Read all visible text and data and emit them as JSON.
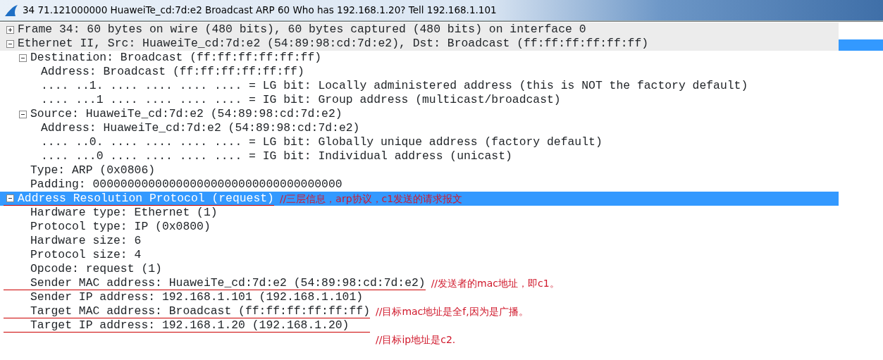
{
  "window": {
    "title": "34 71.121000000 HuaweiTe_cd:7d:e2 Broadcast ARP 60 Who has 192.168.1.20?  Tell 192.168.1.101"
  },
  "tree": [
    {
      "text": "Frame 34: 60 bytes on wire (480 bits), 60 bytes captured (480 bits) on interface 0",
      "expanded": false,
      "selected": false
    },
    {
      "text": "Ethernet II, Src: HuaweiTe_cd:7d:e2 (54:89:98:cd:7d:e2), Dst: Broadcast (ff:ff:ff:ff:ff:ff)",
      "expanded": true,
      "selected": false,
      "marked": true,
      "children": [
        {
          "text": "Destination: Broadcast (ff:ff:ff:ff:ff:ff)",
          "expanded": true,
          "children": [
            {
              "text": "Address: Broadcast (ff:ff:ff:ff:ff:ff)"
            },
            {
              "text": ".... ..1. .... .... .... .... = LG bit: Locally administered address (this is NOT the factory default)"
            },
            {
              "text": ".... ...1 .... .... .... .... = IG bit: Group address (multicast/broadcast)"
            }
          ]
        },
        {
          "text": "Source: HuaweiTe_cd:7d:e2 (54:89:98:cd:7d:e2)",
          "expanded": true,
          "children": [
            {
              "text": "Address: HuaweiTe_cd:7d:e2 (54:89:98:cd:7d:e2)"
            },
            {
              "text": ".... ..0. .... .... .... .... = LG bit: Globally unique address (factory default)"
            },
            {
              "text": ".... ...0 .... .... .... .... = IG bit: Individual address (unicast)"
            }
          ]
        },
        {
          "text": "Type: ARP (0x0806)"
        },
        {
          "text": "Padding: 000000000000000000000000000000000000"
        }
      ]
    },
    {
      "text": "Address Resolution Protocol (request)",
      "expanded": true,
      "selected": true,
      "note": {
        "text": "//三层信息，arp协议，c1发送的请求报文",
        "kind": "inline"
      },
      "children": [
        {
          "text": "Hardware type: Ethernet (1)"
        },
        {
          "text": "Protocol type: IP (0x0800)"
        },
        {
          "text": "Hardware size: 6"
        },
        {
          "text": "Protocol size: 4"
        },
        {
          "text": "Opcode: request (1)"
        },
        {
          "text": "Sender MAC address: HuaweiTe_cd:7d:e2 (54:89:98:cd:7d:e2)",
          "note": {
            "text": "//发送者的mac地址，即c1。",
            "kind": "inline"
          }
        },
        {
          "text": "Sender IP address: 192.168.1.101 (192.168.1.101)"
        },
        {
          "text": "Target MAC address: Broadcast (ff:ff:ff:ff:ff:ff)",
          "note": {
            "text": "//目标mac地址是全f,因为是广播。",
            "kind": "inline"
          }
        },
        {
          "text": "Target IP address: 192.168.1.20 (192.168.1.20)",
          "note": {
            "text": "//目标ip地址是c2.",
            "kind": "below"
          }
        }
      ]
    }
  ]
}
